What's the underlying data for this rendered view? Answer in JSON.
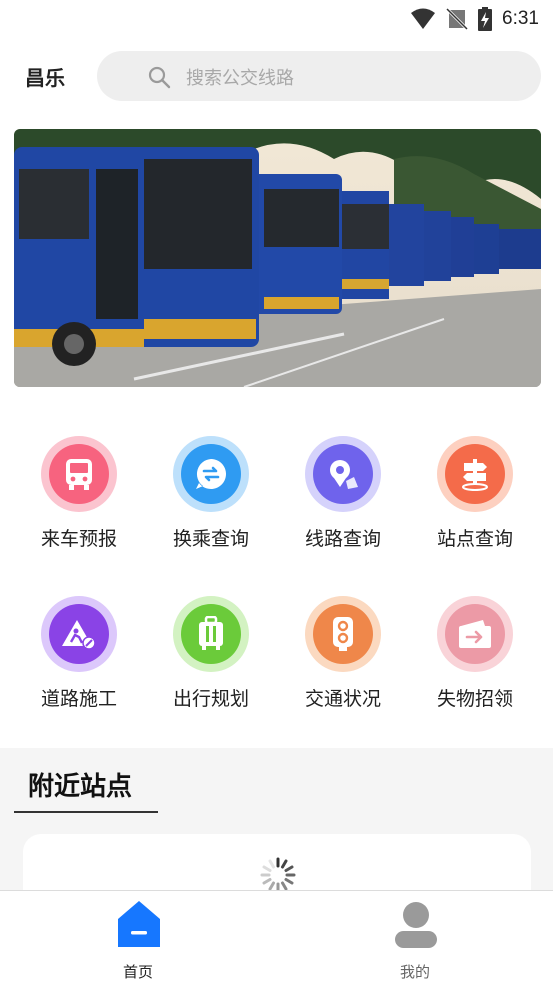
{
  "status_bar": {
    "time": "6:31"
  },
  "header": {
    "city": "昌乐",
    "search_placeholder": "搜索公交线路"
  },
  "banner": {
    "alt": "bus fleet photo"
  },
  "grid": [
    {
      "label": "来车预报",
      "icon": "bus-icon",
      "ring": "#fbc4cf",
      "fill": "#f7637f"
    },
    {
      "label": "换乘查询",
      "icon": "transfer-icon",
      "ring": "#bde0fb",
      "fill": "#2f9bf2"
    },
    {
      "label": "线路查询",
      "icon": "route-pin-icon",
      "ring": "#d5d2fb",
      "fill": "#6f63ec"
    },
    {
      "label": "站点查询",
      "icon": "signpost-icon",
      "ring": "#fdd0c0",
      "fill": "#f46b4a"
    },
    {
      "label": "道路施工",
      "icon": "construction-icon",
      "ring": "#dcc8fb",
      "fill": "#8a43e6"
    },
    {
      "label": "出行规划",
      "icon": "luggage-icon",
      "ring": "#d3f2c2",
      "fill": "#6bcb3a"
    },
    {
      "label": "交通状况",
      "icon": "traffic-light-icon",
      "ring": "#fbd9c0",
      "fill": "#ef874a"
    },
    {
      "label": "失物招领",
      "icon": "wallet-icon",
      "ring": "#f9d3d8",
      "fill": "#ec9aa6"
    }
  ],
  "nearby": {
    "title": "附近站点"
  },
  "bottom_nav": {
    "home_label": "首页",
    "mine_label": "我的",
    "active_color": "#1677ff",
    "inactive_color": "#9a9a9a"
  }
}
